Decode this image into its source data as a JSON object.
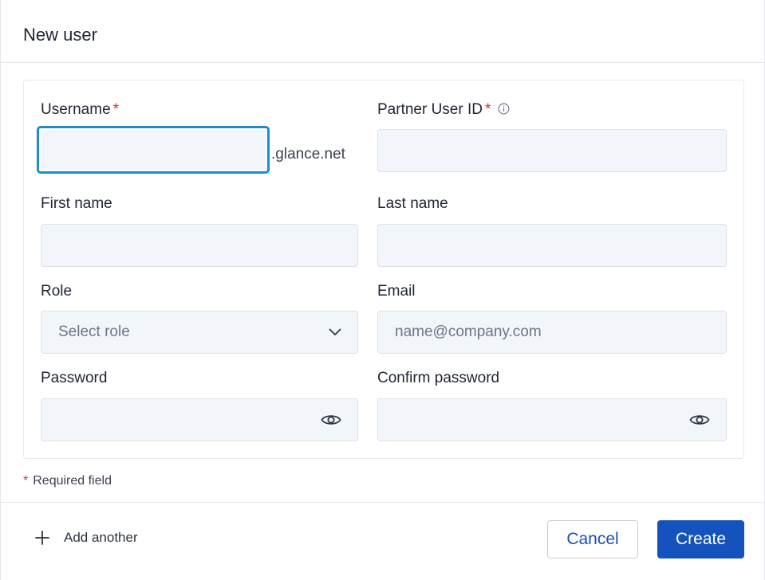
{
  "dialog": {
    "title": "New user"
  },
  "form": {
    "username": {
      "label": "Username",
      "required_mark": "*",
      "value": "",
      "suffix": ".glance.net"
    },
    "partner_user_id": {
      "label": "Partner User ID",
      "required_mark": "*",
      "value": "",
      "icon": "info-icon"
    },
    "first_name": {
      "label": "First name",
      "value": ""
    },
    "last_name": {
      "label": "Last name",
      "value": ""
    },
    "role": {
      "label": "Role",
      "placeholder": "Select role",
      "icon": "chevron-down-icon"
    },
    "email": {
      "label": "Email",
      "placeholder": "name@company.com"
    },
    "password": {
      "label": "Password",
      "value": "",
      "icon": "eye-icon"
    },
    "confirm_password": {
      "label": "Confirm password",
      "value": "",
      "icon": "eye-icon"
    }
  },
  "required_note": {
    "star": "*",
    "text": "Required field"
  },
  "footer": {
    "add_another_label": "Add another",
    "cancel_label": "Cancel",
    "create_label": "Create"
  },
  "colors": {
    "accent": "#1452bd",
    "focus": "#1a8fc6",
    "required": "#d32f2f",
    "field_bg": "#f2f5fa"
  }
}
